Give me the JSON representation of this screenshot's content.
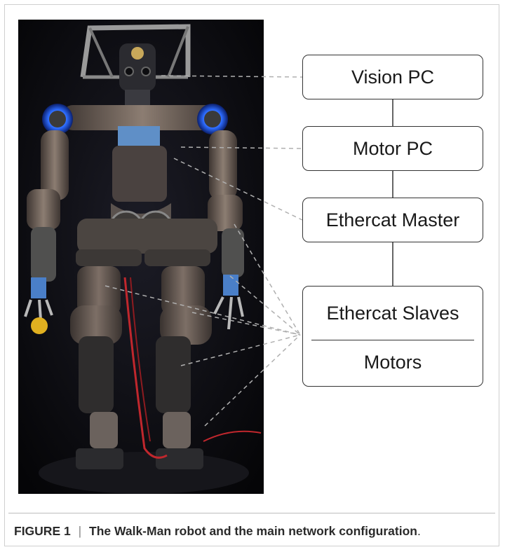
{
  "boxes": {
    "vision_pc": "Vision PC",
    "motor_pc": "Motor PC",
    "ethercat_master": "Ethercat Master",
    "ethercat_slaves": "Ethercat Slaves",
    "motors": "Motors"
  },
  "caption": {
    "label": "FIGURE 1",
    "separator": "|",
    "title": "The Walk-Man robot and the main network configuration",
    "end": "."
  },
  "colors": {
    "photo_background": "#0a0a0f",
    "robot_body": "#6b5d55",
    "led_ring": "#2d6cff",
    "box_border": "#333333",
    "dashed_leader": "#b0b0b0"
  }
}
